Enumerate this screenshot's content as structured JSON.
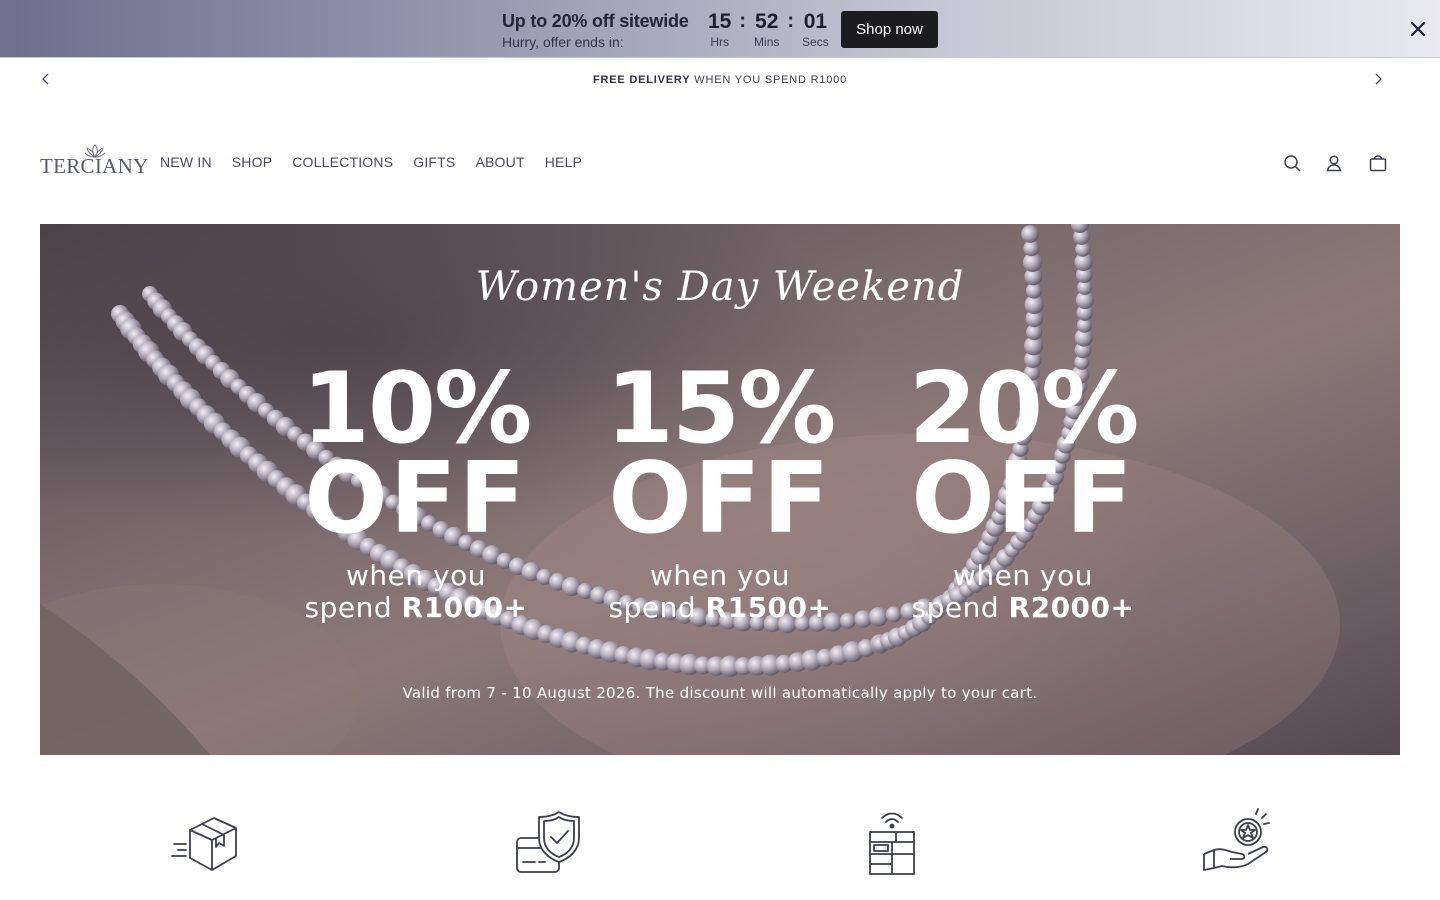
{
  "promo": {
    "title": "Up to 20% off sitewide",
    "subtitle": "Hurry, offer ends in:",
    "timer": {
      "hours": "15",
      "minutes": "52",
      "seconds": "01",
      "hours_label": "Hrs",
      "minutes_label": "Mins",
      "seconds_label": "Secs",
      "separator": ":"
    },
    "cta_label": "Shop now",
    "close_icon": "close-icon"
  },
  "announcement": {
    "bold": "FREE DELIVERY",
    "text": " WHEN YOU SPEND R1000",
    "prev_icon": "chevron-left-icon",
    "next_icon": "chevron-right-icon"
  },
  "header": {
    "logo_text": "TERCIANY",
    "nav": [
      "NEW IN",
      "SHOP",
      "COLLECTIONS",
      "GIFTS",
      "ABOUT",
      "HELP"
    ],
    "icons": [
      "search-icon",
      "account-icon",
      "cart-icon"
    ]
  },
  "hero": {
    "script_title": "Women's Day Weekend",
    "offers": [
      {
        "percent": "10%",
        "off": "OFF",
        "line1": "when you",
        "line2_prefix": "spend ",
        "amount": "R1000+"
      },
      {
        "percent": "15%",
        "off": "OFF",
        "line1": "when you",
        "line2_prefix": "spend ",
        "amount": "R1500+"
      },
      {
        "percent": "20%",
        "off": "OFF",
        "line1": "when you",
        "line2_prefix": "spend ",
        "amount": "R2000+"
      }
    ],
    "note": "Valid from 7 - 10 August 2026. The discount will automatically apply to your cart."
  },
  "benefits": {
    "icons": [
      "delivery-box-icon",
      "secure-payment-icon",
      "parcel-locker-icon",
      "reward-hand-icon"
    ]
  },
  "colors": {
    "button_bg": "#1c1c1f",
    "text_dark": "#2b2b3a",
    "icon_stroke": "#3d3d52"
  }
}
